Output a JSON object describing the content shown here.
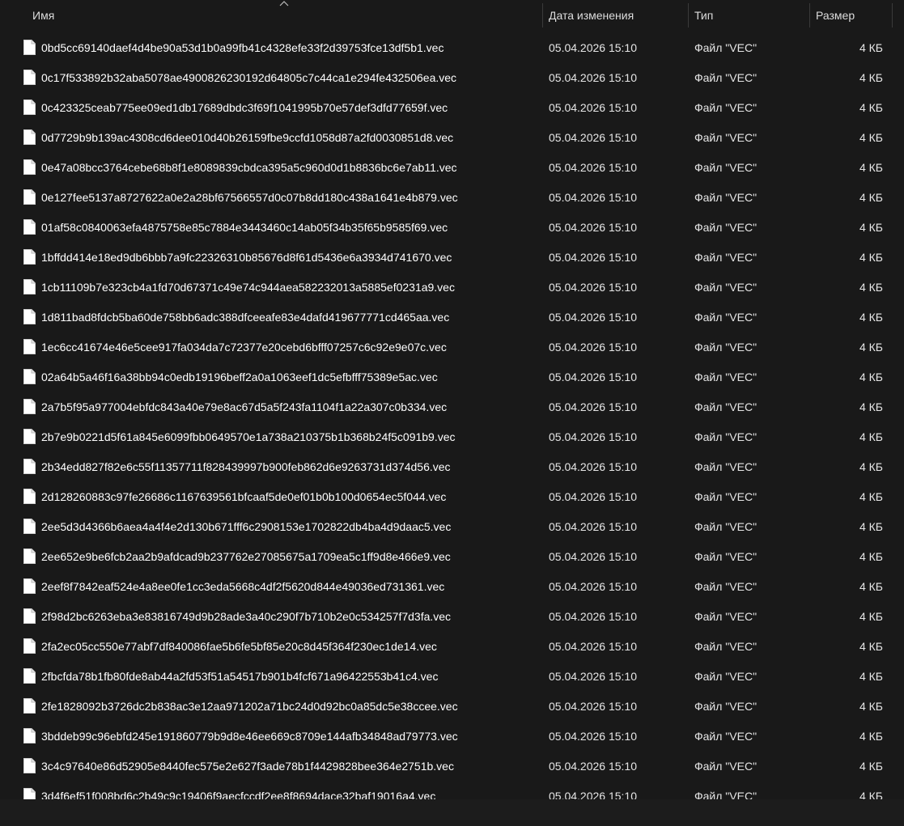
{
  "columns": {
    "name": "Имя",
    "date": "Дата изменения",
    "type": "Тип",
    "size": "Размер"
  },
  "icons": {
    "file": "file-icon",
    "sort": "chevron-up-icon"
  },
  "files": [
    {
      "name": "0bd5cc69140daef4d4be90a53d1b0a99fb41c4328efe33f2d39753fce13df5b1.vec",
      "date": "05.04.2026 15:10",
      "type": "Файл \"VEC\"",
      "size": "4 КБ"
    },
    {
      "name": "0c17f533892b32aba5078ae4900826230192d64805c7c44ca1e294fe432506ea.vec",
      "date": "05.04.2026 15:10",
      "type": "Файл \"VEC\"",
      "size": "4 КБ"
    },
    {
      "name": "0c423325ceab775ee09ed1db17689dbdc3f69f1041995b70e57def3dfd77659f.vec",
      "date": "05.04.2026 15:10",
      "type": "Файл \"VEC\"",
      "size": "4 КБ"
    },
    {
      "name": "0d7729b9b139ac4308cd6dee010d40b26159fbe9ccfd1058d87a2fd0030851d8.vec",
      "date": "05.04.2026 15:10",
      "type": "Файл \"VEC\"",
      "size": "4 КБ"
    },
    {
      "name": "0e47a08bcc3764cebe68b8f1e8089839cbdca395a5c960d0d1b8836bc6e7ab11.vec",
      "date": "05.04.2026 15:10",
      "type": "Файл \"VEC\"",
      "size": "4 КБ"
    },
    {
      "name": "0e127fee5137a8727622a0e2a28bf67566557d0c07b8dd180c438a1641e4b879.vec",
      "date": "05.04.2026 15:10",
      "type": "Файл \"VEC\"",
      "size": "4 КБ"
    },
    {
      "name": "01af58c0840063efa4875758e85c7884e3443460c14ab05f34b35f65b9585f69.vec",
      "date": "05.04.2026 15:10",
      "type": "Файл \"VEC\"",
      "size": "4 КБ"
    },
    {
      "name": "1bffdd414e18ed9db6bbb7a9fc22326310b85676d8f61d5436e6a3934d741670.vec",
      "date": "05.04.2026 15:10",
      "type": "Файл \"VEC\"",
      "size": "4 КБ"
    },
    {
      "name": "1cb11109b7e323cb4a1fd70d67371c49e74c944aea582232013a5885ef0231a9.vec",
      "date": "05.04.2026 15:10",
      "type": "Файл \"VEC\"",
      "size": "4 КБ"
    },
    {
      "name": "1d811bad8fdcb5ba60de758bb6adc388dfceeafe83e4dafd419677771cd465aa.vec",
      "date": "05.04.2026 15:10",
      "type": "Файл \"VEC\"",
      "size": "4 КБ"
    },
    {
      "name": "1ec6cc41674e46e5cee917fa034da7c72377e20cebd6bfff07257c6c92e9e07c.vec",
      "date": "05.04.2026 15:10",
      "type": "Файл \"VEC\"",
      "size": "4 КБ"
    },
    {
      "name": "02a64b5a46f16a38bb94c0edb19196beff2a0a1063eef1dc5efbfff75389e5ac.vec",
      "date": "05.04.2026 15:10",
      "type": "Файл \"VEC\"",
      "size": "4 КБ"
    },
    {
      "name": "2a7b5f95a977004ebfdc843a40e79e8ac67d5a5f243fa1104f1a22a307c0b334.vec",
      "date": "05.04.2026 15:10",
      "type": "Файл \"VEC\"",
      "size": "4 КБ"
    },
    {
      "name": "2b7e9b0221d5f61a845e6099fbb0649570e1a738a210375b1b368b24f5c091b9.vec",
      "date": "05.04.2026 15:10",
      "type": "Файл \"VEC\"",
      "size": "4 КБ"
    },
    {
      "name": "2b34edd827f82e6c55f11357711f828439997b900feb862d6e9263731d374d56.vec",
      "date": "05.04.2026 15:10",
      "type": "Файл \"VEC\"",
      "size": "4 КБ"
    },
    {
      "name": "2d128260883c97fe26686c1167639561bfcaaf5de0ef01b0b100d0654ec5f044.vec",
      "date": "05.04.2026 15:10",
      "type": "Файл \"VEC\"",
      "size": "4 КБ"
    },
    {
      "name": "2ee5d3d4366b6aea4a4f4e2d130b671fff6c2908153e1702822db4ba4d9daac5.vec",
      "date": "05.04.2026 15:10",
      "type": "Файл \"VEC\"",
      "size": "4 КБ"
    },
    {
      "name": "2ee652e9be6fcb2aa2b9afdcad9b237762e27085675a1709ea5c1ff9d8e466e9.vec",
      "date": "05.04.2026 15:10",
      "type": "Файл \"VEC\"",
      "size": "4 КБ"
    },
    {
      "name": "2eef8f7842eaf524e4a8ee0fe1cc3eda5668c4df2f5620d844e49036ed731361.vec",
      "date": "05.04.2026 15:10",
      "type": "Файл \"VEC\"",
      "size": "4 КБ"
    },
    {
      "name": "2f98d2bc6263eba3e83816749d9b28ade3a40c290f7b710b2e0c534257f7d3fa.vec",
      "date": "05.04.2026 15:10",
      "type": "Файл \"VEC\"",
      "size": "4 КБ"
    },
    {
      "name": "2fa2ec05cc550e77abf7df840086fae5b6fe5bf85e20c8d45f364f230ec1de14.vec",
      "date": "05.04.2026 15:10",
      "type": "Файл \"VEC\"",
      "size": "4 КБ"
    },
    {
      "name": "2fbcfda78b1fb80fde8ab44a2fd53f51a54517b901b4fcf671a96422553b41c4.vec",
      "date": "05.04.2026 15:10",
      "type": "Файл \"VEC\"",
      "size": "4 КБ"
    },
    {
      "name": "2fe1828092b3726dc2b838ac3e12aa971202a71bc24d0d92bc0a85dc5e38ccee.vec",
      "date": "05.04.2026 15:10",
      "type": "Файл \"VEC\"",
      "size": "4 КБ"
    },
    {
      "name": "3bddeb99c96ebfd245e191860779b9d8e46ee669c8709e144afb34848ad79773.vec",
      "date": "05.04.2026 15:10",
      "type": "Файл \"VEC\"",
      "size": "4 КБ"
    },
    {
      "name": "3c4c97640e86d52905e8440fec575e2e627f3ade78b1f4429828bee364e2751b.vec",
      "date": "05.04.2026 15:10",
      "type": "Файл \"VEC\"",
      "size": "4 КБ"
    },
    {
      "name": "3d4f6ef51f008bd6c2b49c9c19406f9aecfccdf2ee8f8694dace32baf19016a4.vec",
      "date": "05.04.2026 15:10",
      "type": "Файл \"VEC\"",
      "size": "4 КБ"
    }
  ]
}
